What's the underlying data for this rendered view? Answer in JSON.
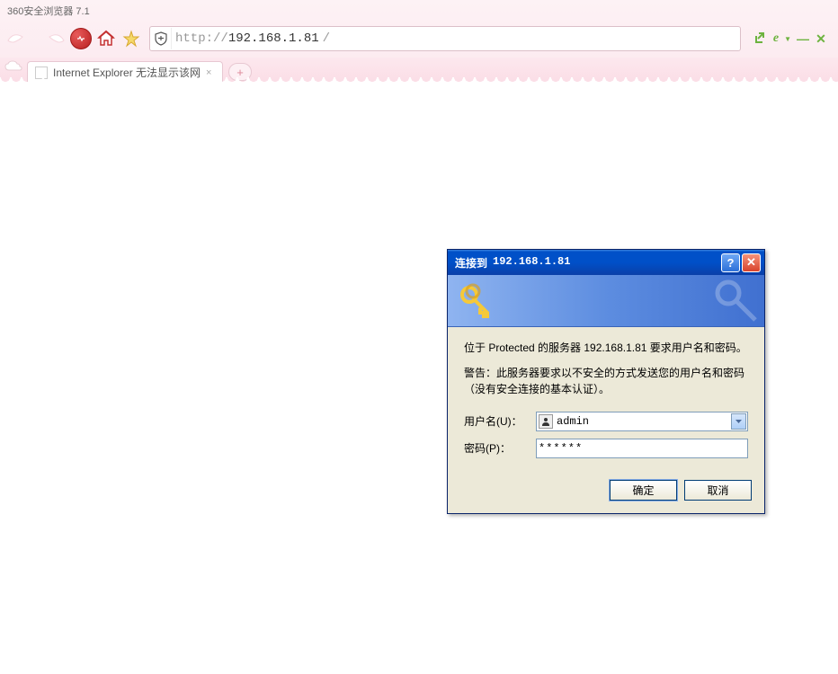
{
  "browser": {
    "title": "360安全浏览器 7.1",
    "url_prefix": "http://",
    "url_host": "192.168.1.81",
    "url_suffix": "/",
    "tab_title": "Internet Explorer 无法显示该网"
  },
  "dialog": {
    "title_prefix": "连接到",
    "title_ip": "192.168.1.81",
    "message1": "位于 Protected 的服务器 192.168.1.81 要求用户名和密码。",
    "message2": "警告：此服务器要求以不安全的方式发送您的用户名和密码（没有安全连接的基本认证）。",
    "username_label": "用户名(U)：",
    "username_value": "admin",
    "password_label": "密码(P)：",
    "password_value": "******",
    "ok_label": "确定",
    "cancel_label": "取消"
  }
}
